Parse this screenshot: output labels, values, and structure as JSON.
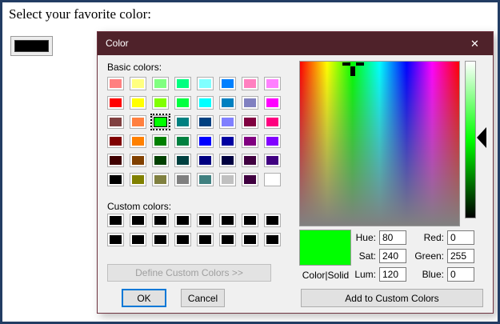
{
  "page": {
    "heading": "Select your favorite color:",
    "swatch_color": "#000000",
    "border_color": "#223c63"
  },
  "dialog": {
    "title": "Color",
    "titlebar_color": "#4f222a",
    "close_icon": "✕",
    "basic_colors_label": "Basic colors:",
    "basic_colors": [
      "#FF8080",
      "#FFFF80",
      "#80FF80",
      "#00FF80",
      "#80FFFF",
      "#0080FF",
      "#FF80C0",
      "#FF80FF",
      "#FF0000",
      "#FFFF00",
      "#80FF00",
      "#00FF40",
      "#00FFFF",
      "#0080C0",
      "#8080C0",
      "#FF00FF",
      "#804040",
      "#FF8040",
      "#00FF00",
      "#008080",
      "#004080",
      "#8080FF",
      "#800040",
      "#FF0080",
      "#800000",
      "#FF8000",
      "#008000",
      "#008040",
      "#0000FF",
      "#0000A0",
      "#800080",
      "#8000FF",
      "#400000",
      "#804000",
      "#004000",
      "#004040",
      "#000080",
      "#000040",
      "#400040",
      "#400080",
      "#000000",
      "#808000",
      "#808040",
      "#808080",
      "#408080",
      "#C0C0C0",
      "#400040",
      "#FFFFFF"
    ],
    "selected_basic_index": 18,
    "selected_color": "#00FF00",
    "custom_colors_label": "Custom colors:",
    "custom_colors": [
      "#000000",
      "#000000",
      "#000000",
      "#000000",
      "#000000",
      "#000000",
      "#000000",
      "#000000",
      "#000000",
      "#000000",
      "#000000",
      "#000000",
      "#000000",
      "#000000",
      "#000000",
      "#000000"
    ],
    "define_button_label": "Define Custom Colors >>",
    "ok_label": "OK",
    "cancel_label": "Cancel",
    "preview": {
      "color": "#00FF00",
      "label": "Color|Solid"
    },
    "fields": {
      "hue": {
        "label": "Hue:",
        "value": "80"
      },
      "sat": {
        "label": "Sat:",
        "value": "240"
      },
      "lum": {
        "label": "Lum:",
        "value": "120"
      },
      "red": {
        "label": "Red:",
        "value": "0"
      },
      "green": {
        "label": "Green:",
        "value": "255"
      },
      "blue": {
        "label": "Blue:",
        "value": "0"
      }
    },
    "add_button_label": "Add to Custom Colors"
  }
}
